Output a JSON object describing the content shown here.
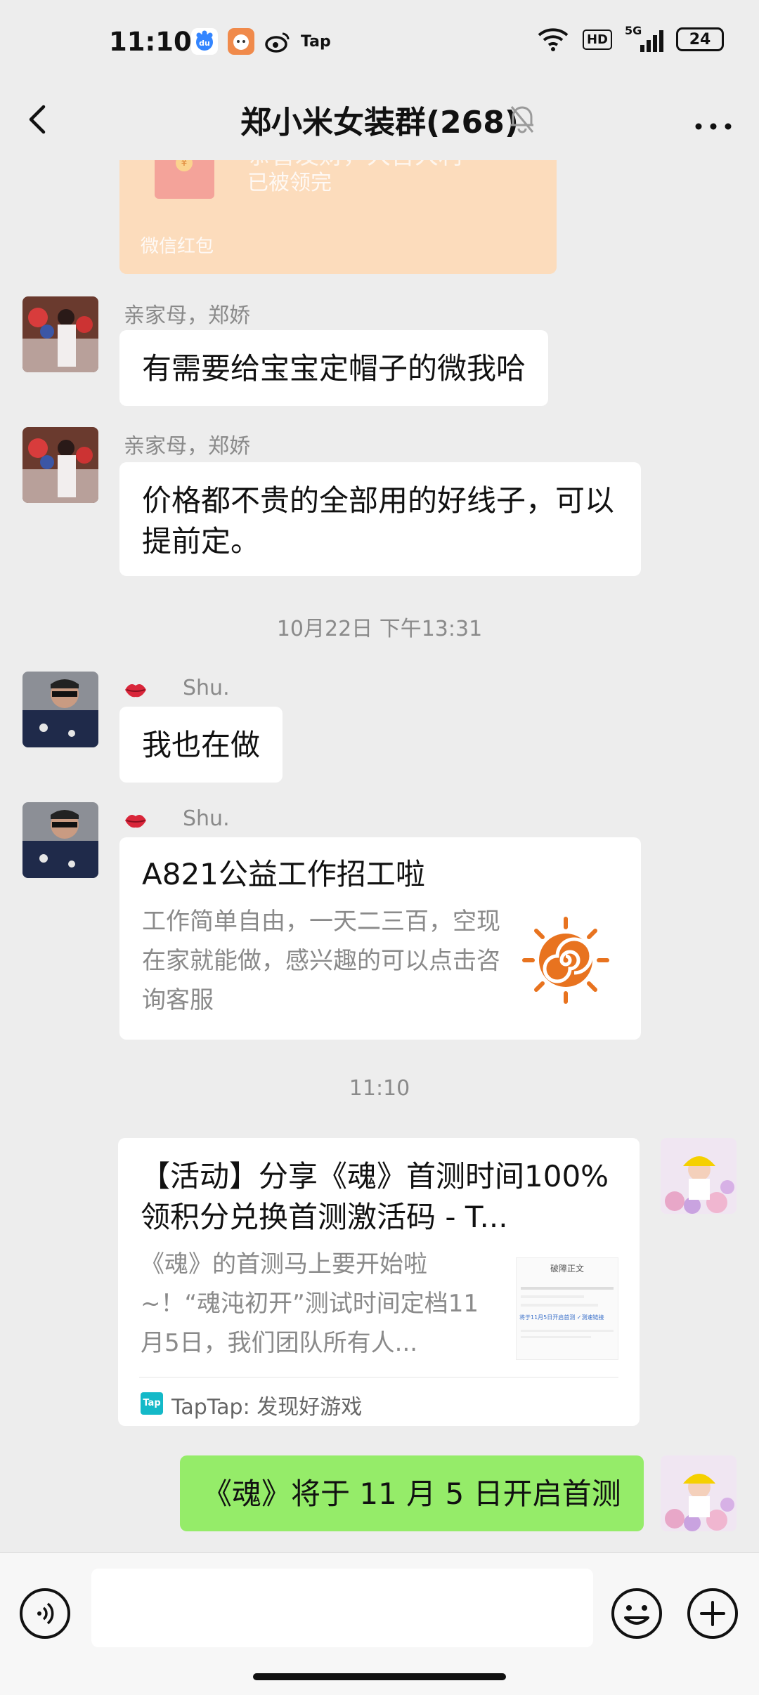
{
  "status": {
    "time": "11:10",
    "tap_label": "Tap",
    "hd": "HD",
    "network": "5G",
    "battery": "24"
  },
  "header": {
    "title": "郑小米女装群(268)"
  },
  "messages": {
    "redpacket": {
      "greeting": "恭喜发财，大吉大利",
      "status": "已被领完",
      "label": "微信红包"
    },
    "m1": {
      "sender": "亲家母，郑娇",
      "text": "有需要给宝宝定帽子的微我哈"
    },
    "m2": {
      "sender": "亲家母，郑娇",
      "text": "价格都不贵的全部用的好线子，可以提前定。"
    },
    "ts1": "10月22日 下午13:31",
    "m3": {
      "sender": "Shu.",
      "text": "我也在做"
    },
    "m4": {
      "sender": "Shu.",
      "title": "A821公益工作招工啦",
      "desc": "工作简单自由，一天二三百，空现在家就能做，感兴趣的可以点击咨询客服"
    },
    "ts2": "11:10",
    "m5": {
      "title": "【活动】分享《魂》首测时间100%领积分兑换首测激活码 - T...",
      "desc": "《魂》的首测马上要开始啦~！“魂沌初开”测试时间定档11月5日，我们团队所有人...",
      "thumb_heading": "破障正文",
      "thumb_line": "将于11月5日开启首测 ✓测速链接",
      "source_icon": "Tap",
      "source": "TapTap: 发现好游戏"
    },
    "m6": {
      "text": "《魂》将于 11 月 5 日开启首测"
    }
  },
  "colors": {
    "bubble_me": "#95ec69",
    "redpacket": "#fcdcbc",
    "background": "#ededed"
  }
}
